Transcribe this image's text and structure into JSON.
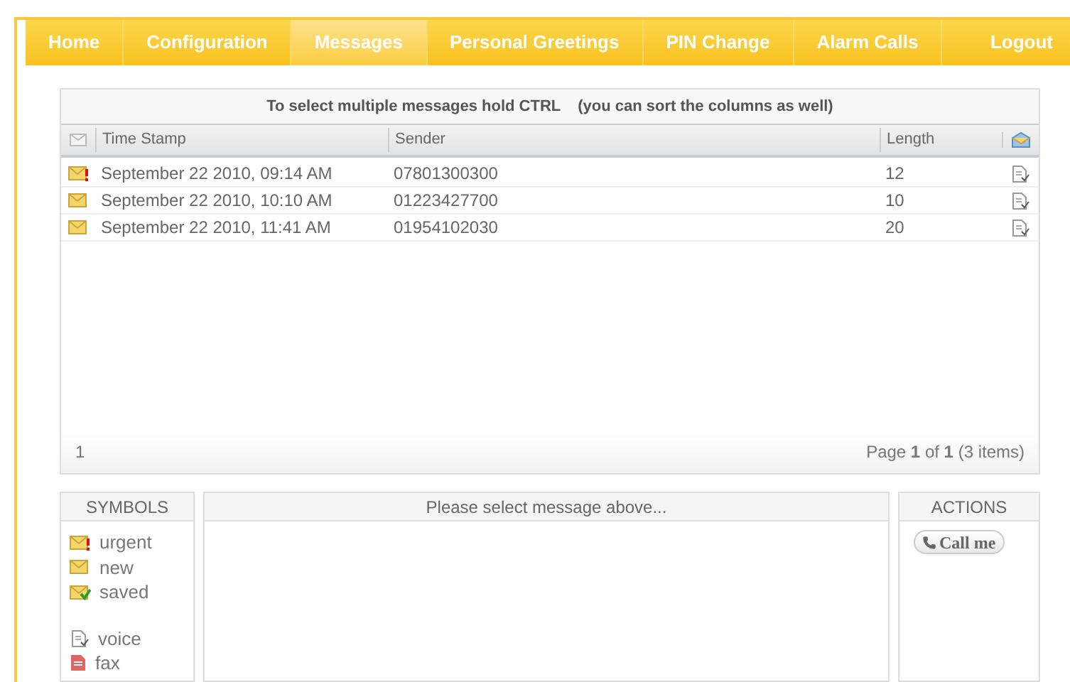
{
  "nav": [
    {
      "label": "Home",
      "selected": false
    },
    {
      "label": "Configuration",
      "selected": false
    },
    {
      "label": "Messages",
      "selected": true
    },
    {
      "label": "Personal Greetings",
      "selected": false
    },
    {
      "label": "PIN Change",
      "selected": false
    },
    {
      "label": "Alarm Calls",
      "selected": false
    },
    {
      "label": "Logout",
      "selected": false
    }
  ],
  "messages": {
    "hint": "To select multiple messages hold CTRL",
    "hint_extra": "(you can sort the columns as well)",
    "columns": [
      "Time Stamp",
      "Sender",
      "Length"
    ],
    "rows": [
      {
        "kind": "urgent",
        "time": "September 22 2010, 09:14 AM",
        "sender": "07801300300",
        "length": "12"
      },
      {
        "kind": "new",
        "time": "September 22 2010, 10:10 AM",
        "sender": "01223427700",
        "length": "10"
      },
      {
        "kind": "new",
        "time": "September 22 2010, 11:41 AM",
        "sender": "01954102030",
        "length": "20"
      }
    ],
    "pages": "1",
    "pager": "Page **1** of **1** (3 items)"
  },
  "symbols": {
    "title": "SYMBOLS",
    "items": [
      {
        "kind": "urgent",
        "label": "urgent"
      },
      {
        "kind": "new",
        "label": "new"
      },
      {
        "kind": "saved",
        "label": "saved"
      },
      {
        "kind": "voice",
        "label": "voice"
      },
      {
        "kind": "fax",
        "label": "fax"
      }
    ]
  },
  "preview": {
    "title": "Please select message above..."
  },
  "actions": {
    "title": "ACTIONS",
    "buttons": [
      "Call me"
    ]
  }
}
